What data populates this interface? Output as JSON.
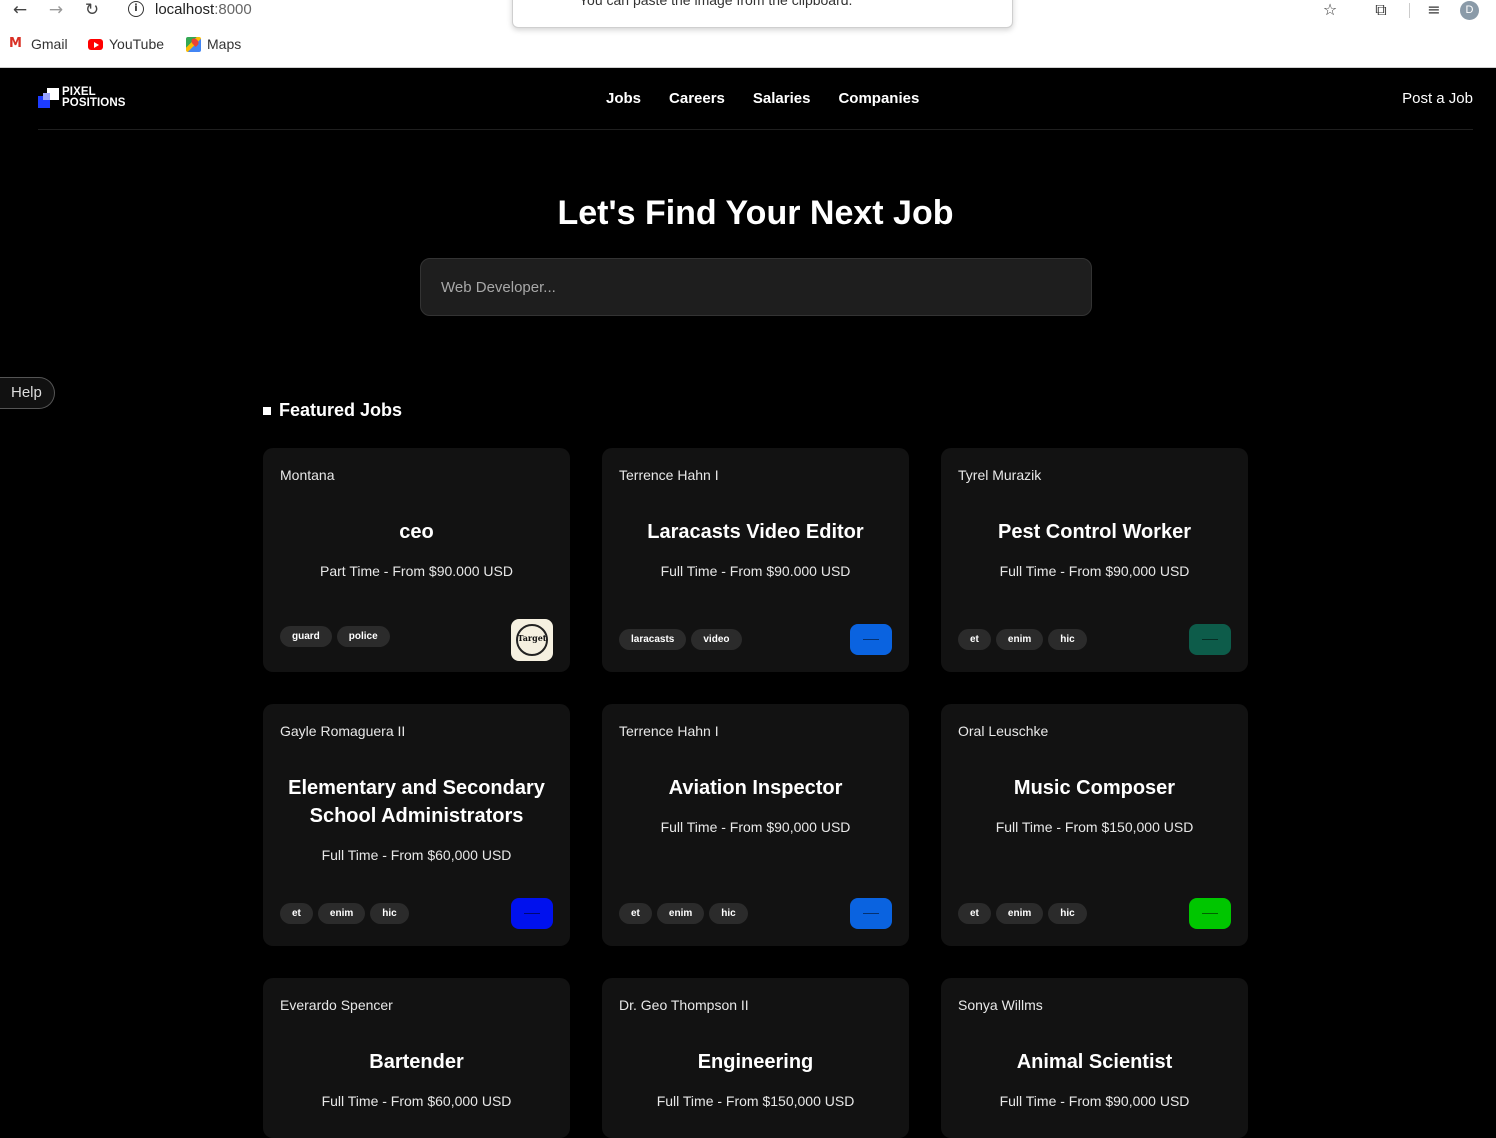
{
  "browser": {
    "url_host": "localhost",
    "url_port": ":8000",
    "popup_text": "You can paste the image from the clipboard.",
    "profile_initial": "D",
    "bookmarks": [
      {
        "label": "Gmail",
        "icon": "gmail-icon"
      },
      {
        "label": "YouTube",
        "icon": "youtube-icon"
      },
      {
        "label": "Maps",
        "icon": "maps-icon"
      }
    ]
  },
  "app": {
    "logo": {
      "line1": "PIXEL",
      "line2": "POSITIONS"
    },
    "nav": [
      "Jobs",
      "Careers",
      "Salaries",
      "Companies"
    ],
    "post_job": "Post a Job",
    "hero_title": "Let's Find Your Next Job",
    "search_placeholder": "Web Developer...",
    "help": "Help",
    "featured_title": "Featured Jobs",
    "jobs": [
      {
        "employer": "Montana",
        "title": "ceo",
        "salary": "Part Time - From $90.000 USD",
        "tags": [
          "guard",
          "police"
        ],
        "logo": "seal",
        "seal_text": "Target",
        "logo_color": "#f5f0e0"
      },
      {
        "employer": "Terrence Hahn I",
        "title": "Laracasts Video Editor",
        "salary": "Full Time - From $90.000 USD",
        "tags": [
          "laracasts",
          "video"
        ],
        "logo": "box",
        "logo_color": "#0a63e0"
      },
      {
        "employer": "Tyrel Murazik",
        "title": "Pest Control Worker",
        "salary": "Full Time - From $90,000 USD",
        "tags": [
          "et",
          "enim",
          "hic"
        ],
        "logo": "box",
        "logo_color": "#0d5c4a"
      },
      {
        "employer": "Gayle Romaguera II",
        "title": "Elementary and Secondary School Administrators",
        "salary": "Full Time - From $60,000 USD",
        "tags": [
          "et",
          "enim",
          "hic"
        ],
        "logo": "box",
        "logo_color": "#0011ee"
      },
      {
        "employer": "Terrence Hahn I",
        "title": "Aviation Inspector",
        "salary": "Full Time - From $90,000 USD",
        "tags": [
          "et",
          "enim",
          "hic"
        ],
        "logo": "box",
        "logo_color": "#0a63e0"
      },
      {
        "employer": "Oral Leuschke",
        "title": "Music Composer",
        "salary": "Full Time - From $150,000 USD",
        "tags": [
          "et",
          "enim",
          "hic"
        ],
        "logo": "box",
        "logo_color": "#00c600"
      },
      {
        "employer": "Everardo Spencer",
        "title": "Bartender",
        "salary": "Full Time - From $60,000 USD",
        "tags": [],
        "logo": "none"
      },
      {
        "employer": "Dr. Geo Thompson II",
        "title": "Engineering",
        "salary": "Full Time - From $150,000 USD",
        "tags": [],
        "logo": "none"
      },
      {
        "employer": "Sonya Willms",
        "title": "Animal Scientist",
        "salary": "Full Time - From $90,000 USD",
        "tags": [],
        "logo": "none"
      }
    ]
  }
}
